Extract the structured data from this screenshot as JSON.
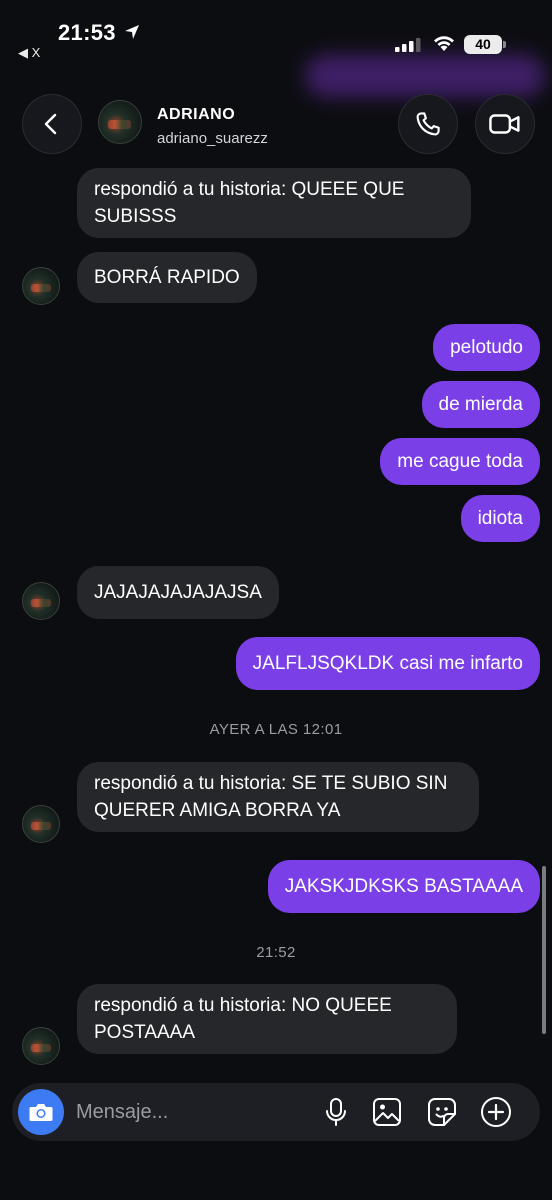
{
  "status_bar": {
    "time": "21:53",
    "back_app": "◀ X",
    "battery": "40"
  },
  "header": {
    "name": "ADRIANO",
    "username": "adriano_suarezz"
  },
  "messages": {
    "m1": "respondió a tu historia: QUEEE QUE SUBISSS",
    "m2": "BORRÁ RAPIDO",
    "m3": "pelotudo",
    "m4": "de mierda",
    "m5": "me cague toda",
    "m6": "idiota",
    "m7": "JAJAJAJAJAJAJSA",
    "m8": "JALFLJSQKLDK casi me infarto",
    "ts1": "AYER A LAS 12:01",
    "m9": "respondió a tu historia: SE TE SUBIO SIN QUERER AMIGA BORRA YA",
    "m10": "JAKSKJDKSKS BASTAAAA",
    "ts2": "21:52",
    "m11": "respondió a tu historia: NO QUEEE POSTAAAA"
  },
  "composer": {
    "placeholder": "Mensaje..."
  },
  "icons": {
    "status": [
      "location-arrow-icon",
      "cellular-signal-icon",
      "wifi-icon",
      "battery-icon"
    ],
    "header": [
      "back-chevron-icon",
      "phone-icon",
      "video-camera-icon"
    ],
    "composer": [
      "camera-icon",
      "microphone-icon",
      "gallery-icon",
      "sticker-icon",
      "add-icon"
    ]
  },
  "colors": {
    "background": "#0c0d11",
    "incoming_bubble": "#26272b",
    "outgoing_bubble": "#7a3fe6",
    "camera_button": "#3d7bf5",
    "timestamp": "#9b9ca2"
  }
}
